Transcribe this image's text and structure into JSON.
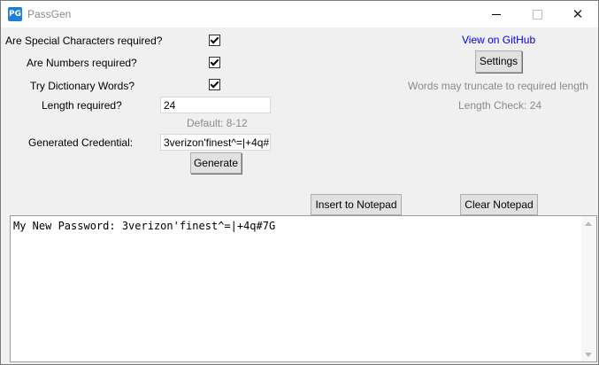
{
  "window": {
    "title": "PassGen",
    "icon_text": "PG",
    "close_glyph": "✕"
  },
  "options": {
    "special_chars_label": "Are Special Characters required?",
    "numbers_label": "Are Numbers required?",
    "dictionary_label": "Try Dictionary Words?",
    "length_label": "Length required?",
    "length_value": "24",
    "length_hint": "Default: 8-12",
    "generated_label": "Generated Credential:",
    "generated_value": "3verizon'finest^=|+4q#"
  },
  "buttons": {
    "generate": "Generate",
    "settings": "Settings",
    "insert": "Insert to Notepad",
    "clear": "Clear Notepad"
  },
  "right_panel": {
    "github_link": "View on GitHub",
    "truncate_note": "Words may truncate to required length",
    "length_check": "Length Check: 24"
  },
  "notepad": {
    "content": "My New Password: 3verizon'finest^=|+4q#7G"
  },
  "colors": {
    "link": "#0000ee",
    "hint": "#8a8a8a",
    "app_icon": "#1e7fd6"
  }
}
